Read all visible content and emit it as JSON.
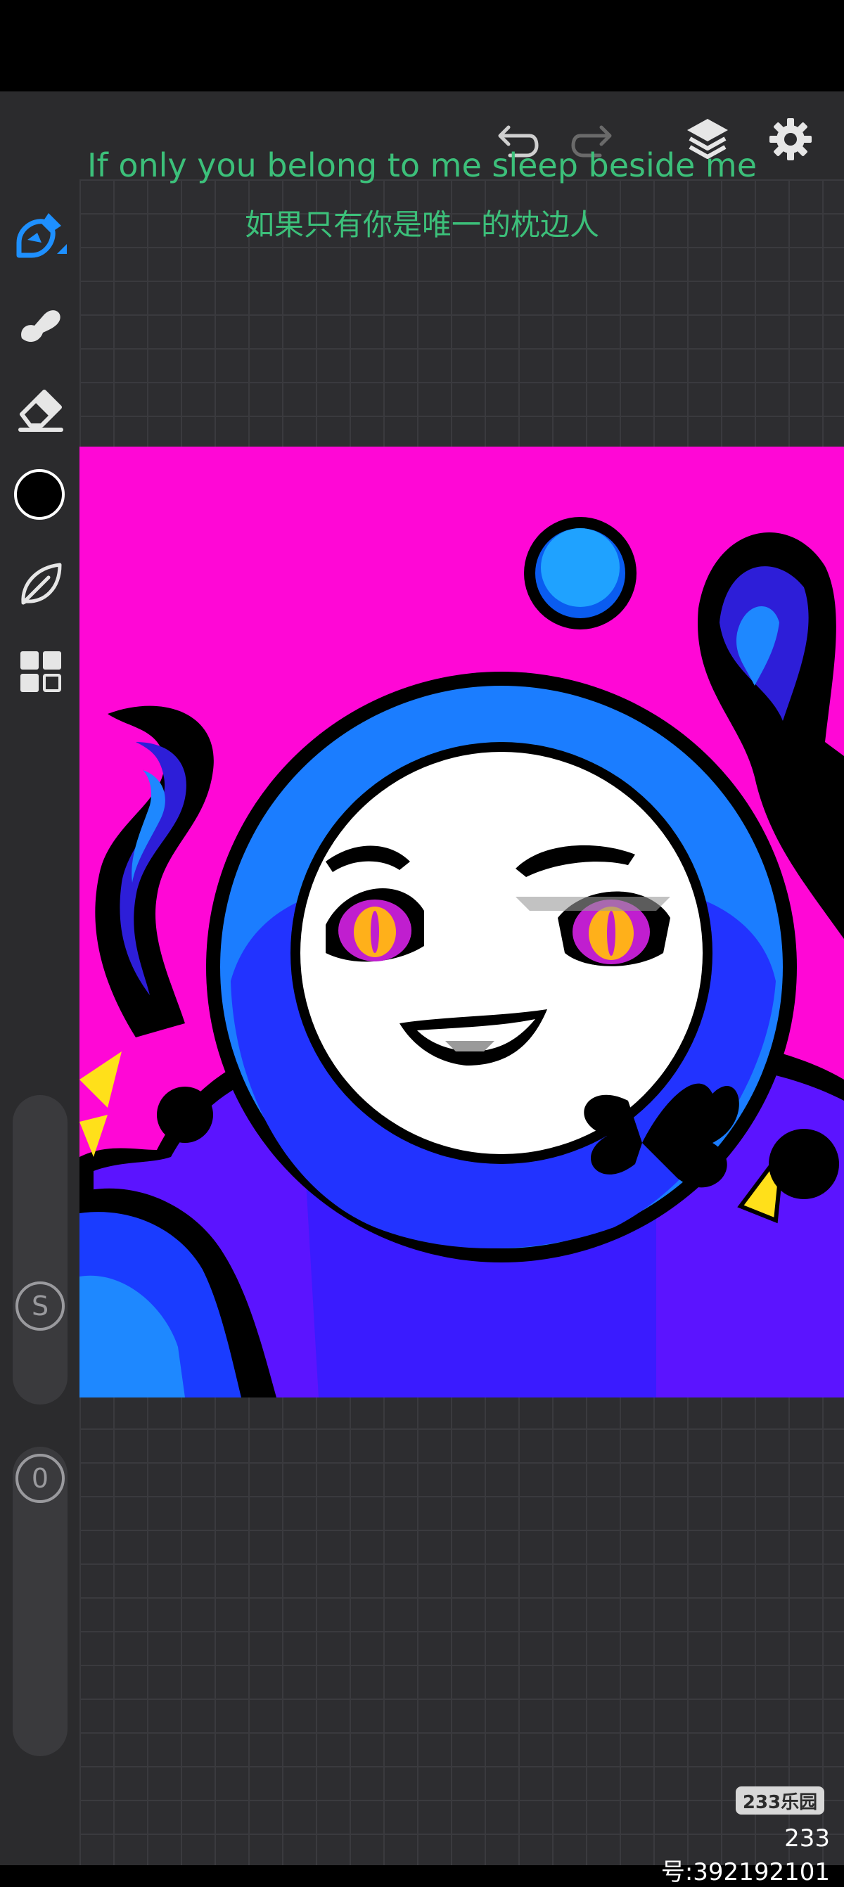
{
  "lyrics": {
    "english": "If only you belong to me sleep beside me",
    "chinese": "如果只有你是唯一的枕边人"
  },
  "colors": {
    "accent": "#1e90ff",
    "canvas_background": "#ff07d6",
    "lyric_text": "#3cc07a",
    "brush_color": "#000000"
  },
  "toolbar": {
    "close_icon": "close-icon",
    "undo_icon": "undo-icon",
    "redo_icon": "redo-icon",
    "layers_icon": "layers-icon",
    "settings_icon": "gear-icon"
  },
  "tools": [
    {
      "name": "pen",
      "icon": "pen-icon",
      "selected": true
    },
    {
      "name": "smudge",
      "icon": "smudge-icon",
      "selected": false
    },
    {
      "name": "eraser",
      "icon": "eraser-icon",
      "selected": false
    },
    {
      "name": "color",
      "icon": "color-swatch",
      "selected": false
    },
    {
      "name": "shape",
      "icon": "leaf-icon",
      "selected": false
    },
    {
      "name": "more",
      "icon": "grid-icon",
      "selected": false
    }
  ],
  "sliders": {
    "size_label": "S",
    "opacity_label": "0"
  },
  "watermark": {
    "logo": "233乐园",
    "id_text": "233号:392192101"
  }
}
